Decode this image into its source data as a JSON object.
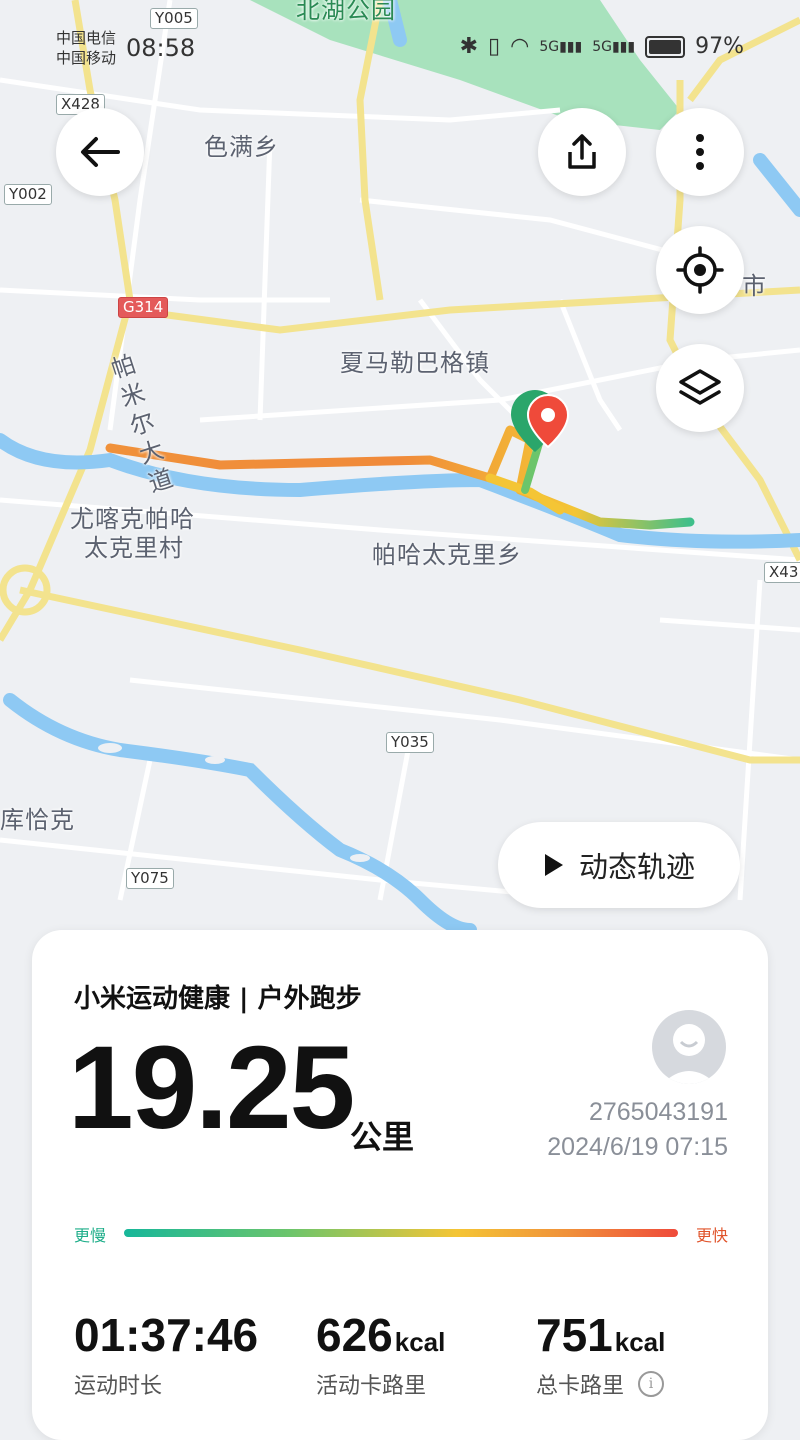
{
  "status_bar": {
    "carrier1": "中国电信",
    "carrier2": "中国移动",
    "time": "08:58",
    "battery": "97%",
    "net1": "5G",
    "net2": "5G"
  },
  "map": {
    "labels": {
      "park": "北湖公园",
      "semanxiang": "色满乡",
      "xiamalebage": "夏马勒巴格镇",
      "pamir": "帕米尔大道",
      "youkashi": "尤喀克帕哈",
      "youkashi2": "太克里村",
      "pahatake": "帕哈太克里乡",
      "kuqiake": "库恰克",
      "city": "市"
    },
    "roads": {
      "y005": "Y005",
      "x428": "X428",
      "y002": "Y002",
      "g314": "G314",
      "y035": "Y035",
      "y075": "Y075",
      "x43": "X43"
    }
  },
  "controls": {
    "back_icon": "arrow-left-icon",
    "share_icon": "share-icon",
    "more_icon": "more-vertical-icon",
    "locate_icon": "locate-icon",
    "layers_icon": "layers-icon",
    "dynamic_track_label": "动态轨迹"
  },
  "summary": {
    "title": "小米运动健康 | 户外跑步",
    "distance": "19.25",
    "distance_unit": "公里",
    "user_id": "2765043191",
    "datetime": "2024/6/19 07:15",
    "pace_slow": "更慢",
    "pace_fast": "更快",
    "stats": [
      {
        "value": "01:37:46",
        "unit": "",
        "label": "运动时长"
      },
      {
        "value": "626",
        "unit": "kcal",
        "label": "活动卡路里"
      },
      {
        "value": "751",
        "unit": "kcal",
        "label": "总卡路里"
      }
    ]
  },
  "colors": {
    "route_slow": "#17b79a",
    "route_fast": "#ef4a3a",
    "river": "#8ec9f3",
    "road_major": "#f2e08a",
    "park": "#9ee0b4"
  }
}
